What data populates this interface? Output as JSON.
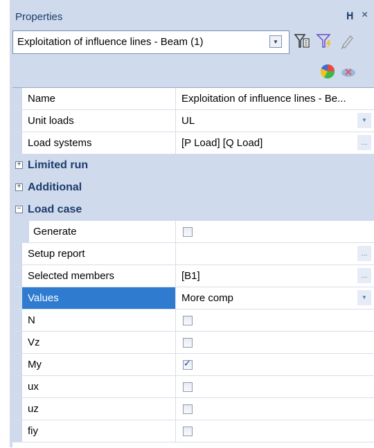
{
  "panel": {
    "title": "Properties",
    "pin_glyph": "q",
    "close_glyph": "×"
  },
  "selector": {
    "value": "Exploitation of influence lines - Beam (1)"
  },
  "toolbar": {
    "icons": [
      "filter-select-icon",
      "filter-lightning-icon",
      "pencil-edit-icon",
      "color-palette-icon",
      "remove-color-icon"
    ]
  },
  "rows": {
    "name": {
      "label": "Name",
      "value": "Exploitation of influence lines - Be..."
    },
    "unit_loads": {
      "label": "Unit loads",
      "value": "UL"
    },
    "load_systems": {
      "label": "Load systems",
      "value": "[P Load] [Q Load]"
    },
    "limited_run": {
      "label": "Limited run",
      "expander": "+"
    },
    "additional": {
      "label": "Additional",
      "expander": "+"
    },
    "load_case": {
      "label": "Load case",
      "expander": "−"
    },
    "generate": {
      "label": "Generate",
      "checked": false
    },
    "setup_report": {
      "label": "Setup report",
      "value": ""
    },
    "selected_members": {
      "label": "Selected members",
      "value": "[B1]"
    },
    "values": {
      "label": "Values",
      "value": "More comp"
    },
    "n": {
      "label": "N",
      "checked": false
    },
    "vz": {
      "label": "Vz",
      "checked": false
    },
    "my": {
      "label": "My",
      "checked": true
    },
    "ux": {
      "label": "ux",
      "checked": false
    },
    "uz": {
      "label": "uz",
      "checked": false
    },
    "fiy": {
      "label": "fiy",
      "checked": false
    }
  },
  "buttons": {
    "ellipsis": "...",
    "dropdown": "▼"
  },
  "colors": {
    "panel_bg": "#cfdbec",
    "category_text": "#1e3a6e",
    "selection": "#2f7bd0"
  }
}
